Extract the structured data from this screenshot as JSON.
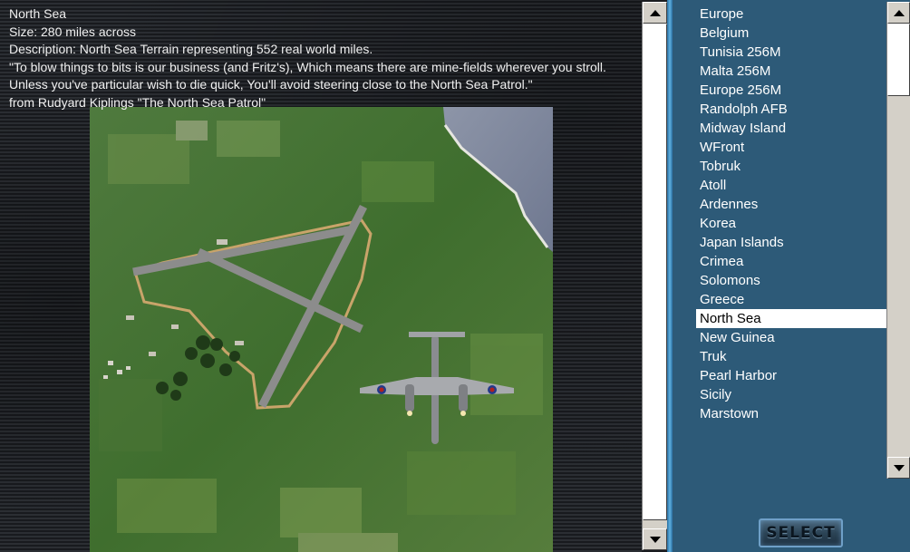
{
  "info": {
    "title": "North Sea",
    "size": "Size: 280 miles across",
    "description": "Description: North Sea Terrain representing 552 real world miles.",
    "quote": "\"To blow things to bits is our business (and Fritz's), Which means there are mine-fields wherever you stroll. Unless you've particular wish to die quick, You'll avoid steering close to the North Sea Patrol.\"",
    "attribution": "from Rudyard Kiplings \"The North Sea Patrol\""
  },
  "maps": [
    "Europe",
    "Belgium",
    "Tunisia 256M",
    "Malta 256M",
    "Europe 256M",
    "Randolph AFB",
    "Midway Island",
    "WFront",
    "Tobruk",
    "Atoll",
    "Ardennes",
    "Korea",
    "Japan Islands",
    "Crimea",
    "Solomons",
    "Greece",
    "North Sea",
    "New Guinea",
    "Truk",
    "Pearl Harbor",
    "Sicily",
    "Marstown"
  ],
  "selected_map": "North Sea",
  "select_button": "SELECT",
  "icons": {
    "scroll_up": "arrow-up-icon",
    "scroll_down": "arrow-down-icon"
  },
  "colors": {
    "list_background": "#2d5a78",
    "divider": "#5fb0e0",
    "selection": "#ffffff"
  }
}
